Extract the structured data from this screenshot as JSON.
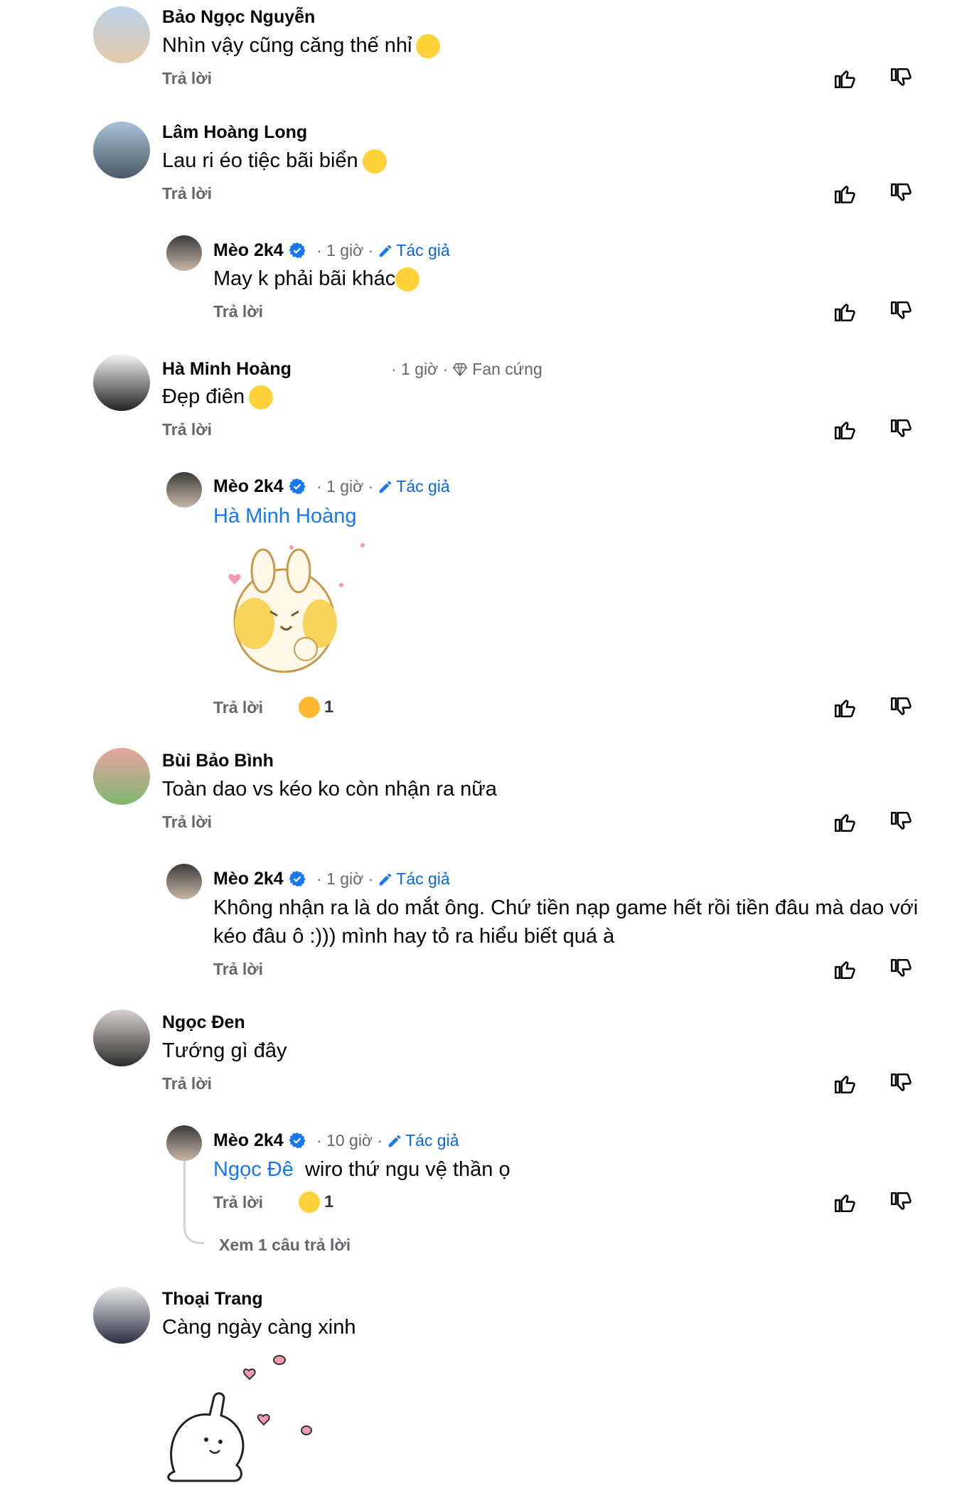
{
  "comments": [
    {
      "name": "Bảo Ngọc Nguyễn",
      "meta": "",
      "text": "Nhìn vậy cũng căng thế nhỉ",
      "reply": "Trả lời"
    },
    {
      "name": "Lâm Hoàng Long",
      "meta": "",
      "text": "Lau ri éo tiệc bãi biển",
      "reply": "Trả lời"
    },
    {
      "name": "Mèo 2k4",
      "meta": "· 1 giờ ·",
      "badge": "Tác giả",
      "text": "May k phải bãi khác",
      "reply": "Trả lời"
    },
    {
      "name": "Hà Minh Hoàng",
      "meta": "· 1 giờ ·",
      "badge": "Fan cứng",
      "text": "Đẹp điên",
      "reply": "Trả lời"
    },
    {
      "name": "Mèo 2k4",
      "meta": "· 1 giờ ·",
      "badge": "Tác giả",
      "mention": "Hà Minh Hoàng",
      "reply": "Trả lời",
      "reaction_count": "1"
    },
    {
      "name": "Bùi Bảo Bình",
      "meta": "",
      "text": "Toàn dao vs kéo ko còn nhận ra nữa",
      "reply": "Trả lời"
    },
    {
      "name": "Mèo 2k4",
      "meta": "· 1 giờ ·",
      "badge": "Tác giả",
      "text": "Không nhận ra là do mắt ông. Chứ tiền nạp game hết rồi tiền đâu mà dao với kéo đâu ô :))) mình hay tỏ ra hiểu biết quá à",
      "reply": "Trả lời"
    },
    {
      "name": "Ngọc Đen",
      "meta": "",
      "text": "Tướng gì đây",
      "reply": "Trả lời"
    },
    {
      "name": "Mèo 2k4",
      "meta": "· 10 giờ ·",
      "badge": "Tác giả",
      "mention": "Ngọc Đê",
      "text": "wiro thứ ngu vệ thần ọ",
      "reply": "Trả lời",
      "reaction_count": "1"
    },
    {
      "name": "Thoại Trang",
      "meta": "",
      "text": "Càng ngày càng xinh"
    }
  ],
  "view_more": "Xem 1 câu trả lời",
  "icons": {
    "like": "thumbs-up-icon",
    "dislike": "thumbs-down-icon",
    "verified": "verified-badge-icon",
    "pencil": "pencil-icon",
    "diamond": "diamond-icon"
  },
  "colors": {
    "accent": "#1877f2",
    "muted": "#65676b"
  }
}
